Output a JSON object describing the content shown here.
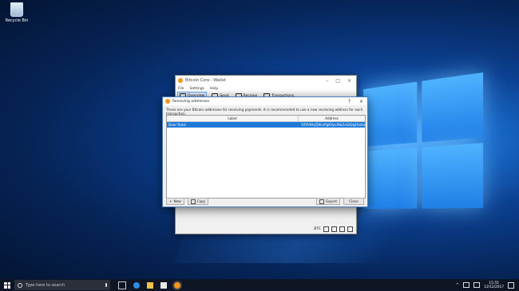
{
  "desktop": {
    "recycle_bin_label": "Recycle Bin"
  },
  "main_window": {
    "title": "Bitcoin Core - Wallet",
    "menu": [
      "File",
      "Settings",
      "Help"
    ],
    "toolbar": [
      "Overview",
      "Send",
      "Receive",
      "Transactions"
    ],
    "status_unit": "BTC"
  },
  "dialog": {
    "title": "Receiving addresses",
    "help_glyph": "?",
    "close_glyph": "×",
    "description": "These are your Bitcoin addresses for receiving payments. It is recommended to use a new receiving address for each transaction.",
    "columns": {
      "label": "Label",
      "address": "Address"
    },
    "rows": [
      {
        "label": "Dear Rank",
        "address": "1PZVWqTJKkvPgKXpcWaZxGIQq4XxKaeSi"
      }
    ],
    "buttons": {
      "new": "New",
      "copy": "Copy",
      "export": "Export",
      "close": "Close"
    }
  },
  "taskbar": {
    "search_placeholder": "Type here to search",
    "time": "15:55",
    "date": "12/12/2017"
  },
  "colors": {
    "selection": "#1e7ad6",
    "taskbar": "#0e1626",
    "bitcoin": "#f7931a"
  }
}
